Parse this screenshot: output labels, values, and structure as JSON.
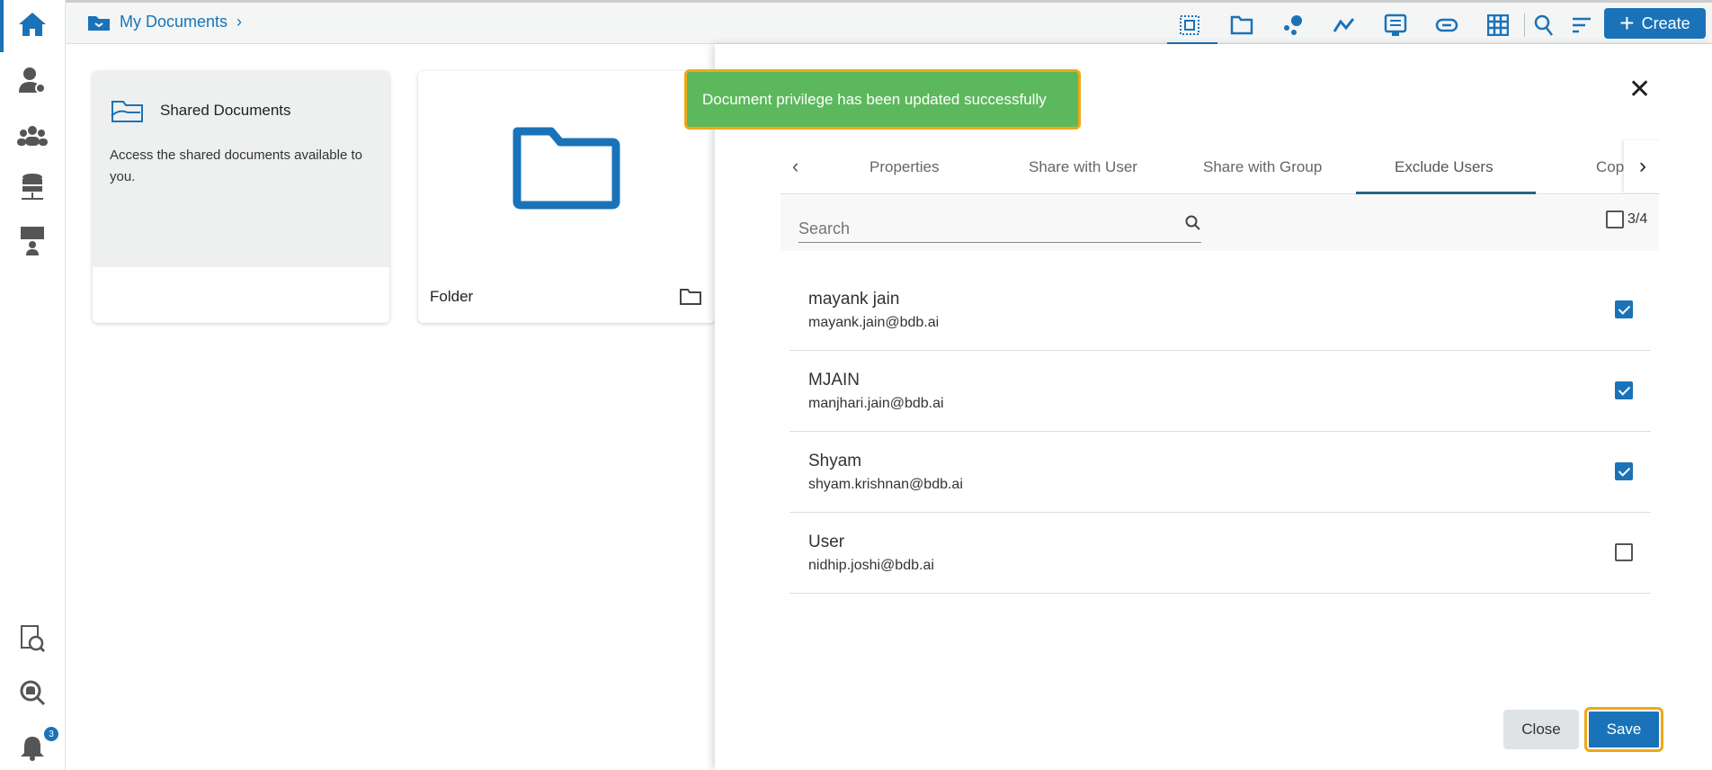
{
  "breadcrumb": {
    "label": "My Documents"
  },
  "toolbar": {
    "create_label": "Create"
  },
  "sidebar": {
    "notification_count": "3"
  },
  "cards": [
    {
      "title": "Shared Documents",
      "description": "Access the shared documents available to you."
    },
    {
      "title": "Folder"
    }
  ],
  "toast": {
    "message": "Document privilege has been updated successfully"
  },
  "panel": {
    "tabs": [
      "Properties",
      "Share with User",
      "Share with Group",
      "Exclude Users",
      "Cop"
    ],
    "active_tab": "Exclude Users",
    "search_placeholder": "Search",
    "selected_count": "3/4",
    "users": [
      {
        "name": "mayank jain",
        "email": "mayank.jain@bdb.ai",
        "checked": true
      },
      {
        "name": "MJAIN",
        "email": "manjhari.jain@bdb.ai",
        "checked": true
      },
      {
        "name": "Shyam",
        "email": "shyam.krishnan@bdb.ai",
        "checked": true
      },
      {
        "name": "User",
        "email": "nidhip.joshi@bdb.ai",
        "checked": false
      }
    ],
    "close_label": "Close",
    "save_label": "Save"
  },
  "colors": {
    "accent": "#1a73b8",
    "toast": "#5cb85c",
    "highlight": "#f0a818"
  }
}
